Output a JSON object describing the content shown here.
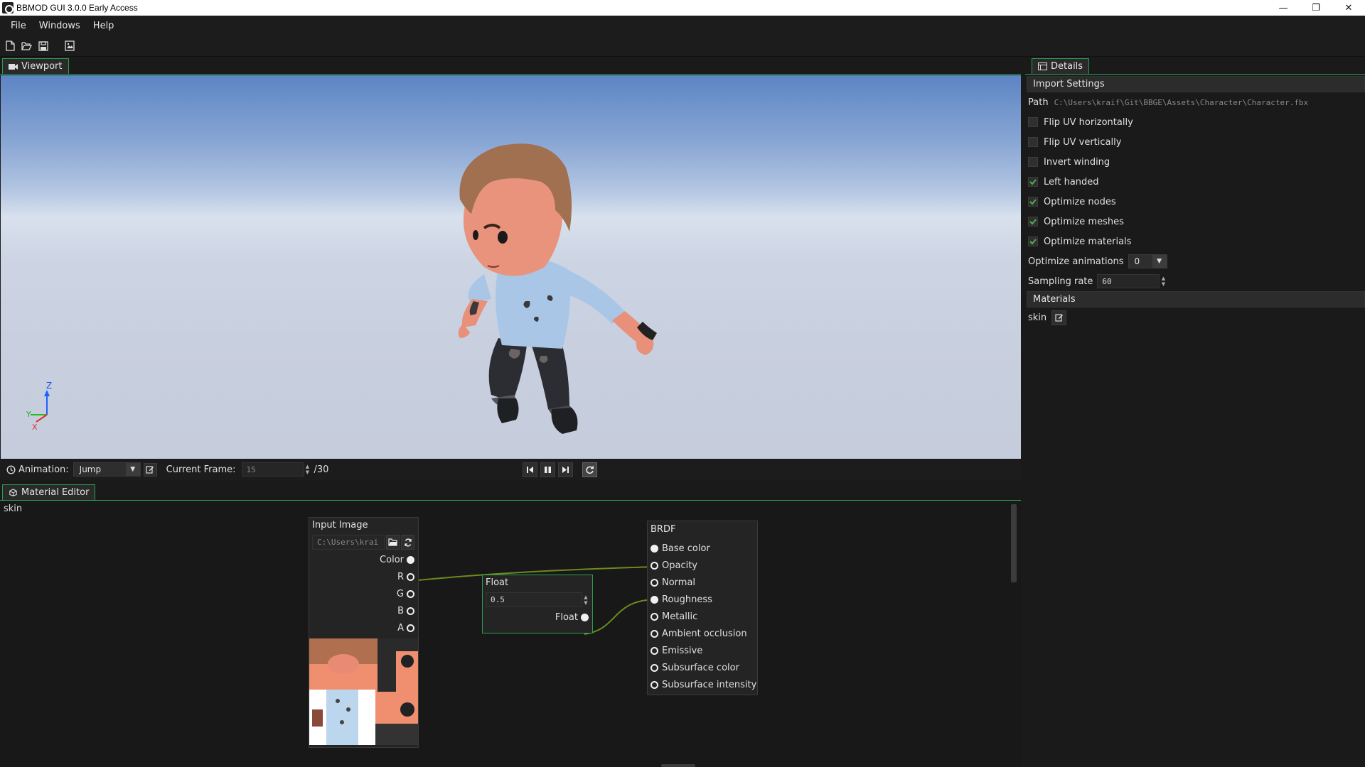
{
  "window": {
    "title": "BBMOD GUI 3.0.0 Early Access",
    "min": "—",
    "max": "❐",
    "close": "✕"
  },
  "menu": [
    "File",
    "Windows",
    "Help"
  ],
  "viewport": {
    "tab_label": "Viewport",
    "axis_z": "Z",
    "axis_y": "Y",
    "axis_x": "X"
  },
  "anim_bar": {
    "animation_label": "Animation:",
    "animation_value": "Jump",
    "current_frame_label": "Current Frame:",
    "current_frame_value": "15",
    "total_frames": "/30"
  },
  "material_editor": {
    "tab_label": "Material Editor",
    "material_name": "skin",
    "input_image": {
      "title": "Input Image",
      "path": "C:\\Users\\krai",
      "outputs": [
        "Color",
        "R",
        "G",
        "B",
        "A"
      ]
    },
    "float_node": {
      "title": "Float",
      "value": "0.5",
      "output": "Float"
    },
    "brdf": {
      "title": "BRDF",
      "inputs": [
        "Base color",
        "Opacity",
        "Normal",
        "Roughness",
        "Metallic",
        "Ambient occlusion",
        "Emissive",
        "Subsurface color",
        "Subsurface intensity"
      ],
      "connected": [
        true,
        false,
        false,
        true,
        false,
        false,
        false,
        false,
        false
      ]
    },
    "link_color": "#6e8a1e"
  },
  "details": {
    "tab_label": "Details",
    "import_settings": "Import Settings",
    "path_label": "Path",
    "path_value": "C:\\Users\\kraif\\Git\\BBGE\\Assets\\Character\\Character.fbx",
    "checkboxes": [
      {
        "label": "Flip UV horizontally",
        "checked": false
      },
      {
        "label": "Flip UV vertically",
        "checked": false
      },
      {
        "label": "Invert winding",
        "checked": false
      },
      {
        "label": "Left handed",
        "checked": true
      },
      {
        "label": "Optimize nodes",
        "checked": true
      },
      {
        "label": "Optimize meshes",
        "checked": true
      },
      {
        "label": "Optimize materials",
        "checked": true
      }
    ],
    "optimize_animations_label": "Optimize animations",
    "optimize_animations_value": "0",
    "sampling_rate_label": "Sampling rate",
    "sampling_rate_value": "60",
    "materials_header": "Materials",
    "material_item": "skin"
  },
  "colors": {
    "accent": "#2aa050",
    "check": "#4caf50"
  }
}
